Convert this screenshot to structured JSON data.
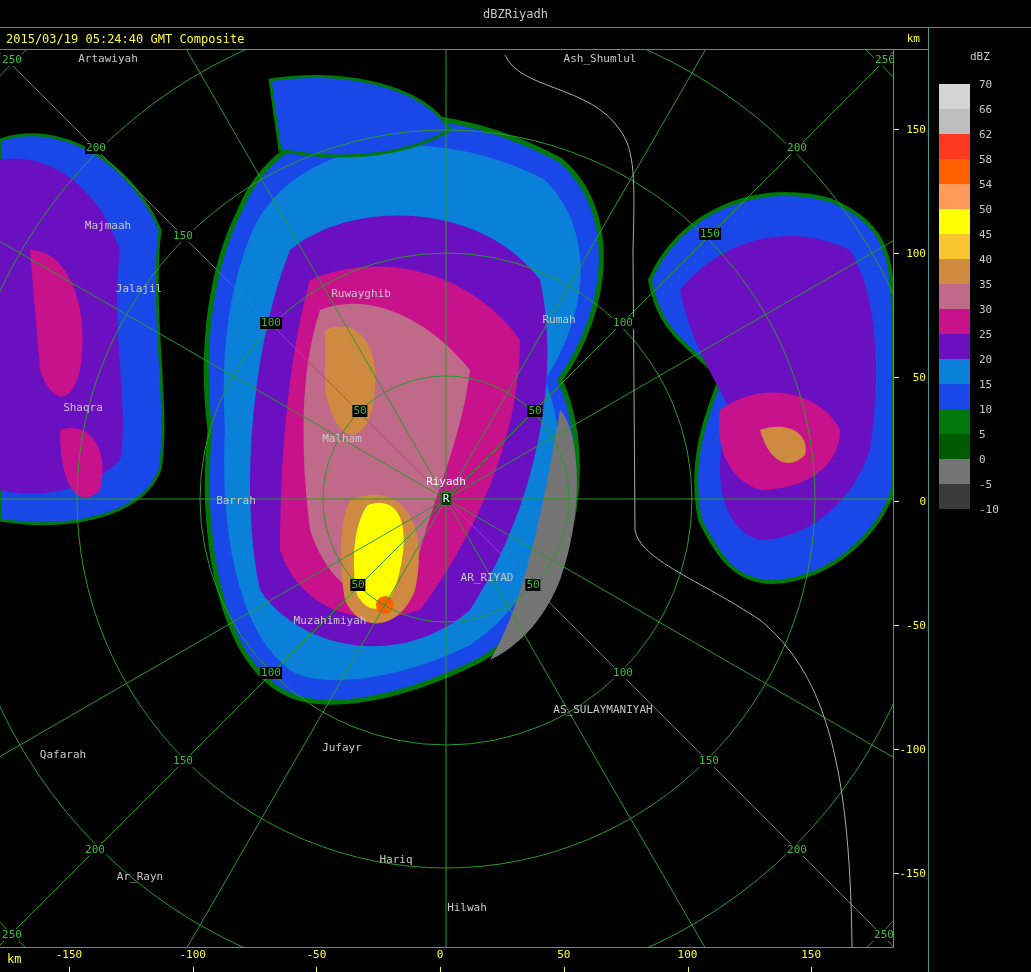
{
  "window": {
    "title": "dBZRiyadh"
  },
  "header": {
    "timestamp": "2015/03/19 05:24:40 GMT Composite",
    "unit": "km"
  },
  "map_labels": [
    {
      "text": "Artawiyah",
      "kind": "city"
    },
    {
      "text": "Ash_Shumlul",
      "kind": "city"
    },
    {
      "text": "Majmaah",
      "kind": "city"
    },
    {
      "text": "Jalajil",
      "kind": "city"
    },
    {
      "text": "Ruwayghib",
      "kind": "city"
    },
    {
      "text": "Rumah",
      "kind": "city"
    },
    {
      "text": "Shaqra",
      "kind": "city"
    },
    {
      "text": "Malham",
      "kind": "city"
    },
    {
      "text": "Riyadh",
      "kind": "radar"
    },
    {
      "text": "R",
      "kind": "site"
    },
    {
      "text": "Barrah",
      "kind": "city"
    },
    {
      "text": "AR_RIYAD",
      "kind": "city"
    },
    {
      "text": "Muzahimiyah",
      "kind": "city"
    },
    {
      "text": "AS_SULAYMANIYAH",
      "kind": "city"
    },
    {
      "text": "Jufayr",
      "kind": "city"
    },
    {
      "text": "Qafarah",
      "kind": "city"
    },
    {
      "text": "Hariq",
      "kind": "city"
    },
    {
      "text": "Ar_Rayn",
      "kind": "city"
    },
    {
      "text": "Hilwah",
      "kind": "city"
    }
  ],
  "range_labels": [
    "250",
    "250",
    "250",
    "250",
    "200",
    "200",
    "200",
    "200",
    "150",
    "150",
    "150",
    "150",
    "100",
    "100",
    "100",
    "100",
    "50",
    "50",
    "50",
    "50"
  ],
  "y_axis": {
    "ticks": [
      "150",
      "100",
      "50",
      "0",
      "-50",
      "-100",
      "-150"
    ]
  },
  "x_axis": {
    "unit": "km",
    "ticks": [
      "-150",
      "-100",
      "-50",
      "0",
      "50",
      "100",
      "150"
    ]
  },
  "legend": {
    "unit": "dBZ",
    "ticks": [
      "70",
      "66",
      "62",
      "58",
      "54",
      "50",
      "45",
      "40",
      "35",
      "30",
      "25",
      "20",
      "15",
      "10",
      "5",
      "0",
      "-5",
      "-10"
    ],
    "bands": [
      {
        "color": "#d4d4d4"
      },
      {
        "color": "#bebebe"
      },
      {
        "color": "#ff3a20"
      },
      {
        "color": "#ff6000"
      },
      {
        "color": "#ff9a5a"
      },
      {
        "color": "#ffff00"
      },
      {
        "color": "#f8c430"
      },
      {
        "color": "#cd8a40"
      },
      {
        "color": "#bf6a88"
      },
      {
        "color": "#c8128c"
      },
      {
        "color": "#6a10c0"
      },
      {
        "color": "#0a80d8"
      },
      {
        "color": "#1a48e8"
      },
      {
        "color": "#00780a"
      },
      {
        "color": "#005a00"
      },
      {
        "color": "#747474"
      },
      {
        "color": "#3a3a3a"
      }
    ]
  }
}
